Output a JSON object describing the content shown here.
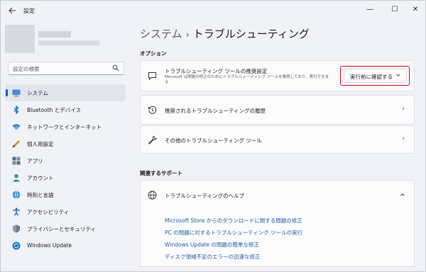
{
  "window": {
    "title": "設定",
    "minimize": "—",
    "maximize": "☐",
    "close": "✕"
  },
  "search": {
    "placeholder": "設定の検索"
  },
  "sidebar": {
    "items": [
      {
        "label": "システム",
        "icon": "system-icon",
        "active": true
      },
      {
        "label": "Bluetooth とデバイス",
        "icon": "bluetooth-icon"
      },
      {
        "label": "ネットワークとインターネット",
        "icon": "network-icon"
      },
      {
        "label": "個人用設定",
        "icon": "personalization-icon"
      },
      {
        "label": "アプリ",
        "icon": "apps-icon"
      },
      {
        "label": "アカウント",
        "icon": "account-icon"
      },
      {
        "label": "時刻と言語",
        "icon": "time-language-icon"
      },
      {
        "label": "アクセシビリティ",
        "icon": "accessibility-icon"
      },
      {
        "label": "プライバシーとセキュリティ",
        "icon": "privacy-icon"
      },
      {
        "label": "Windows Update",
        "icon": "windows-update-icon"
      }
    ]
  },
  "breadcrumb": {
    "parent": "システム",
    "separator": "›",
    "current": "トラブルシューティング"
  },
  "options": {
    "heading": "オプション",
    "recommended": {
      "title": "トラブルシューティング ツールの推奨設定",
      "description": "Microsoft は問題の修正のためにトラブルシューティング ツールを推奨しており、実行できます",
      "dropdown_value": "実行前に確認する"
    },
    "history": {
      "title": "推奨されるトラブルシューティングの履歴"
    },
    "other": {
      "title": "その他のトラブルシューティング ツール"
    }
  },
  "support": {
    "heading": "関連するサポート",
    "help": {
      "title": "トラブルシューティングのヘルプ"
    },
    "links": [
      "Microsoft Store からのダウンロードに関する問題の修正",
      "PC の問題に対するトラブルシューティング ツールの実行",
      "Windows Update の問題の簡単な修正",
      "ディスク領域不足のエラーの迅速な修正"
    ]
  },
  "colors": {
    "accent": "#0a5fbf",
    "link": "#1d5fa8",
    "highlight": "#e0001b"
  }
}
